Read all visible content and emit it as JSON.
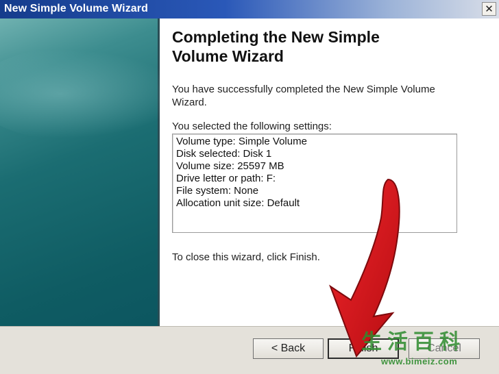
{
  "window": {
    "title": "New Simple Volume Wizard",
    "close_glyph": "✕"
  },
  "content": {
    "heading_line1": "Completing the New Simple",
    "heading_line2": "Volume Wizard",
    "success_text": "You have successfully completed the New Simple Volume Wizard.",
    "settings_label": "You selected the following settings:",
    "settings": [
      "Volume type: Simple Volume",
      "Disk selected: Disk 1",
      "Volume size: 25597 MB",
      "Drive letter or path: F:",
      "File system: None",
      "Allocation unit size: Default"
    ],
    "close_instruction": "To close this wizard, click Finish."
  },
  "buttons": {
    "back": "< Back",
    "finish": "Finish",
    "cancel": "Cancel"
  },
  "watermark": {
    "logo_text": "生活百科",
    "url": "www.bimeiz.com"
  },
  "colors": {
    "titlebar_start": "#153c8c",
    "left_panel": "#0f5c63",
    "annotation_arrow": "#e0151c"
  },
  "icons": {
    "annotation": "red-arrow-pointing-to-finish"
  }
}
